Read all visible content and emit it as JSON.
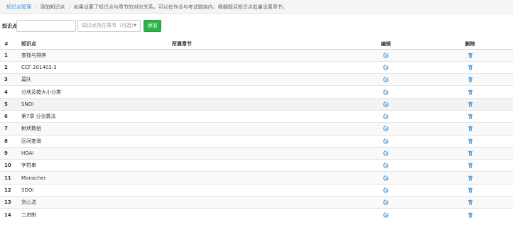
{
  "breadcrumb": {
    "root": "知识点管理",
    "sep": "/",
    "current": "添加知识点",
    "description": "如果设置了知识点与章节的对应关系，可以在作业与考试题库内，根据题目知识点批量设置章节。"
  },
  "form": {
    "label": "知识点",
    "input_value": "",
    "select_placeholder": "知识点所在章节（可选）",
    "add_label": "添加"
  },
  "table": {
    "headers": {
      "num": "#",
      "name": "知识点",
      "chapter": "所属章节",
      "edit": "编辑",
      "delete": "删除"
    },
    "rows": [
      {
        "num": "1",
        "name": "查找与排序",
        "chapter": ""
      },
      {
        "num": "2",
        "name": "CCF 201403-3",
        "chapter": ""
      },
      {
        "num": "3",
        "name": "莫队",
        "chapter": ""
      },
      {
        "num": "4",
        "name": "分块及按大小分类",
        "chapter": ""
      },
      {
        "num": "5",
        "name": "SNOI",
        "chapter": ""
      },
      {
        "num": "6",
        "name": "第7章 分治算法",
        "chapter": ""
      },
      {
        "num": "7",
        "name": "树状数组",
        "chapter": ""
      },
      {
        "num": "8",
        "name": "区间查询",
        "chapter": ""
      },
      {
        "num": "9",
        "name": "HOAI",
        "chapter": ""
      },
      {
        "num": "10",
        "name": "字符串",
        "chapter": ""
      },
      {
        "num": "11",
        "name": "Manacher",
        "chapter": ""
      },
      {
        "num": "12",
        "name": "SDOI",
        "chapter": ""
      },
      {
        "num": "13",
        "name": "贪心法",
        "chapter": ""
      },
      {
        "num": "14",
        "name": "二进制",
        "chapter": ""
      }
    ]
  },
  "icons": {
    "edit": "edit-icon",
    "delete": "trash-icon",
    "dropdown": "caret-down-icon"
  },
  "colors": {
    "link": "#3a8fd4",
    "add_button": "#2db34a",
    "icon": "#3a8fd4"
  }
}
